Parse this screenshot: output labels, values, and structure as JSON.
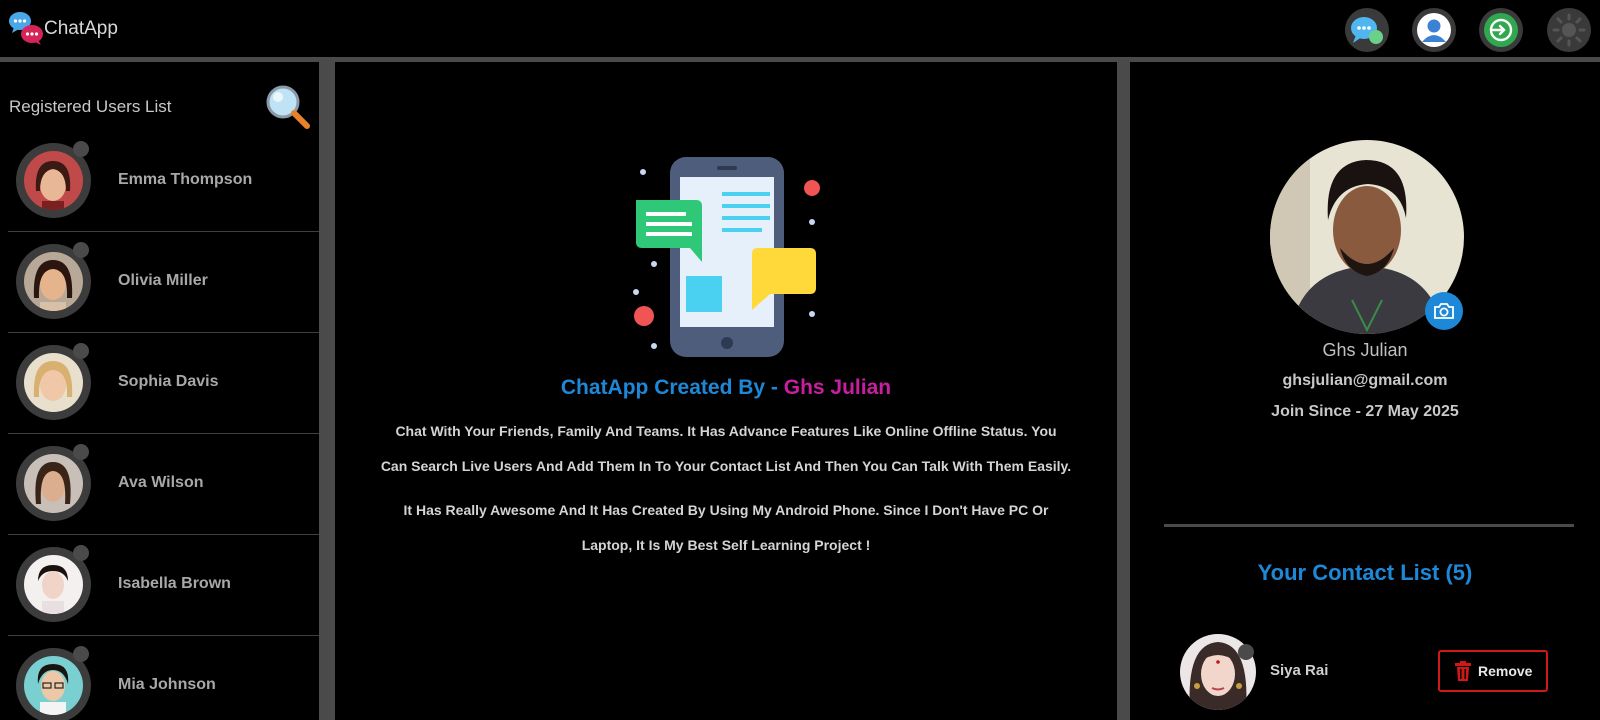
{
  "header": {
    "app_name": "ChatApp",
    "buttons": [
      {
        "name": "chats-icon"
      },
      {
        "name": "profile-icon"
      },
      {
        "name": "logout-icon"
      },
      {
        "name": "theme-toggle-icon"
      }
    ]
  },
  "sidebar": {
    "title": "Registered Users List",
    "users": [
      {
        "name": "Emma Thompson"
      },
      {
        "name": "Olivia Miller"
      },
      {
        "name": "Sophia Davis"
      },
      {
        "name": "Ava Wilson"
      },
      {
        "name": "Isabella Brown"
      },
      {
        "name": "Mia Johnson"
      }
    ]
  },
  "main": {
    "credit_prefix": "ChatApp Created By - ",
    "credit_author": "Ghs Julian",
    "paragraph1_line1": "Chat With Your Friends, Family And Teams. It Has Advance Features Like Online Offline Status. You",
    "paragraph1_line2": "Can Search Live Users And Add Them In To Your Contact List And Then You Can Talk With Them Easily.",
    "paragraph2_line1": "It Has Really Awesome And It Has Created By Using My Android Phone. Since I Don't Have PC Or",
    "paragraph2_line2": "Laptop, It Is My Best Self Learning Project !"
  },
  "profile": {
    "name": "Ghs Julian",
    "email": "ghsjulian@gmail.com",
    "join": "Join Since - 27 May 2025"
  },
  "contacts": {
    "title": "Your Contact List (5)",
    "items": [
      {
        "name": "Siya Rai",
        "action": "Remove"
      }
    ]
  },
  "colors": {
    "accent_blue": "#1e88d8",
    "accent_magenta": "#c81ea0",
    "danger_red": "#d01818",
    "panel_border": "#4a4a4a"
  }
}
